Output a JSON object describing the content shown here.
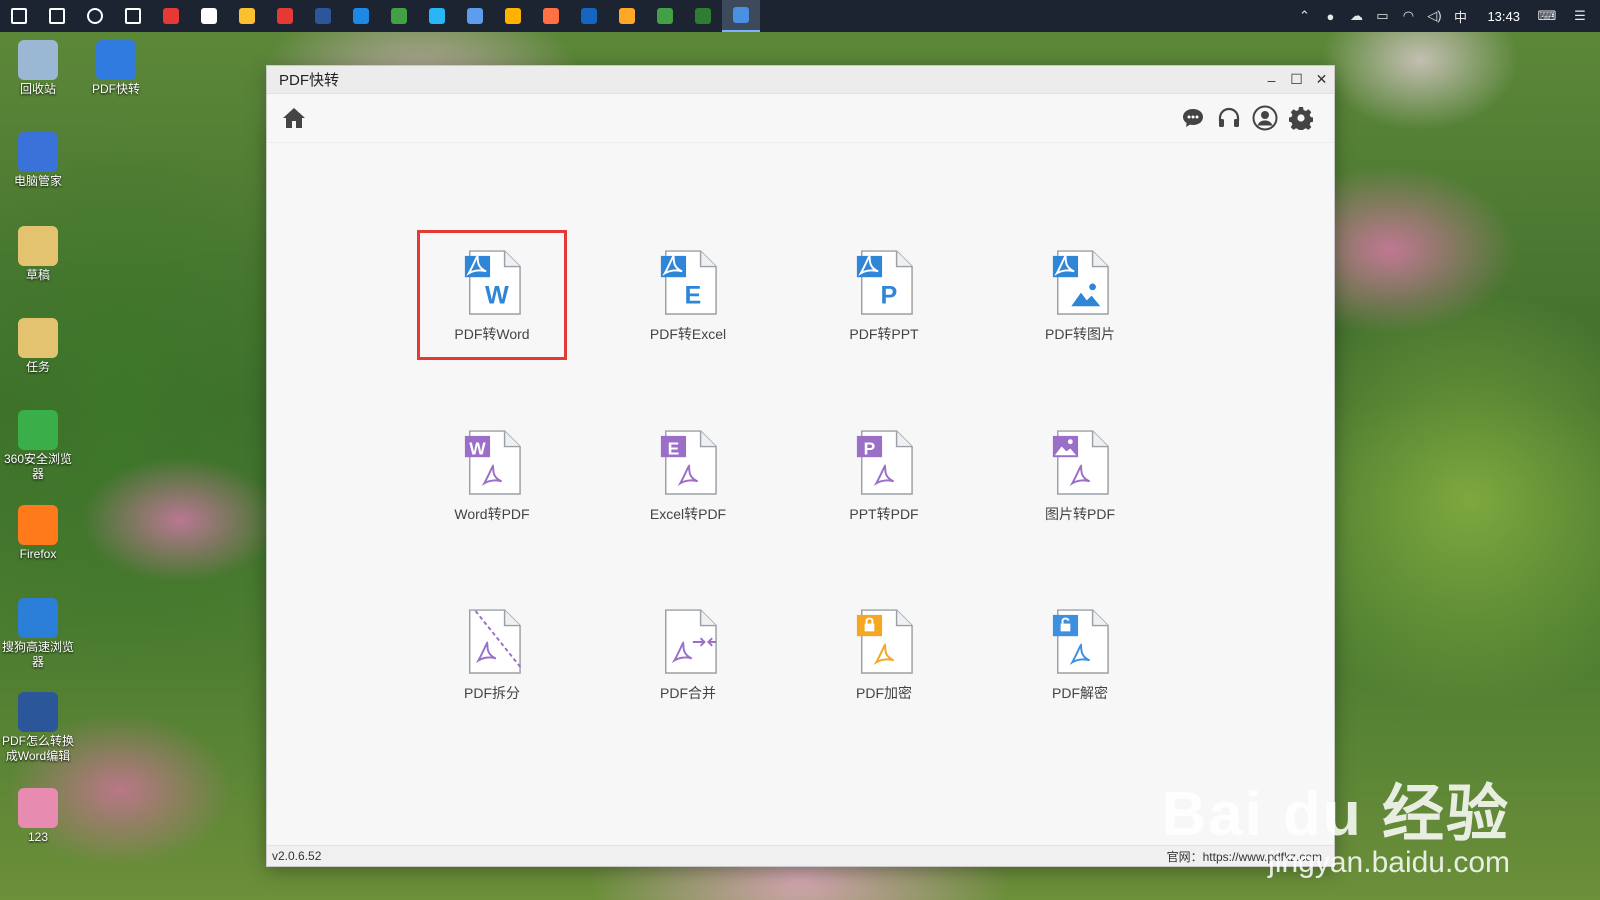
{
  "taskbar": {
    "icons": [
      {
        "name": "windows-start-icon",
        "color": "#ffffff"
      },
      {
        "name": "search-icon",
        "color": "#ffffff"
      },
      {
        "name": "cortana-icon",
        "color": "#ffffff"
      },
      {
        "name": "task-view-icon",
        "color": "#ffffff"
      },
      {
        "name": "app-red-icon",
        "color": "#e53935"
      },
      {
        "name": "file-white-icon",
        "color": "#ffffff"
      },
      {
        "name": "app-yellow-icon",
        "color": "#fbc02d"
      },
      {
        "name": "weibo-icon",
        "color": "#e53935"
      },
      {
        "name": "word-icon",
        "color": "#2b579a"
      },
      {
        "name": "edge-icon",
        "color": "#1e88e5"
      },
      {
        "name": "chrome-icon",
        "color": "#43a047"
      },
      {
        "name": "app-blue-icon",
        "color": "#29b6f6"
      },
      {
        "name": "app-pen-icon",
        "color": "#5c9ded"
      },
      {
        "name": "qq-icon",
        "color": "#ffb300"
      },
      {
        "name": "app-orange-icon",
        "color": "#ff7043"
      },
      {
        "name": "photoshop-icon",
        "color": "#1565c0"
      },
      {
        "name": "app-smile-icon",
        "color": "#ffa726"
      },
      {
        "name": "wechat-icon",
        "color": "#43a047"
      },
      {
        "name": "excel-icon",
        "color": "#2e7d32"
      },
      {
        "name": "pdf-kuaizhuan-taskbar-icon",
        "color": "#4a90e2",
        "active": true
      }
    ],
    "tray": {
      "ime": "中",
      "time": "13:43"
    }
  },
  "desktop": {
    "icons": [
      {
        "label": "回收站",
        "color": "#9ab7d3"
      },
      {
        "label": "PDF快转",
        "color": "#2f7be0"
      },
      {
        "label": "电脑管家",
        "color": "#3b72d9"
      },
      {
        "label": "草稿",
        "color": "#e3c370"
      },
      {
        "label": "任务",
        "color": "#e3c370"
      },
      {
        "label": "360安全浏览器",
        "color": "#3aae49"
      },
      {
        "label": "Firefox",
        "color": "#ff7a1a"
      },
      {
        "label": "搜狗高速浏览器",
        "color": "#2b7fd9"
      },
      {
        "label": "PDF怎么转换成Word编辑",
        "color": "#2b579a"
      },
      {
        "label": "123",
        "color": "#e88bb0"
      }
    ]
  },
  "window": {
    "title": "PDF快转",
    "controls": {
      "minimize": "–",
      "maximize": "☐",
      "close": "✕"
    },
    "version": "v2.0.6.52",
    "site": "官网：https://www.pdfkz.com"
  },
  "tools": [
    {
      "label": "PDF转Word",
      "letter": "W",
      "kind": "pdf-to",
      "accent": "#2f86d6",
      "selected": true
    },
    {
      "label": "PDF转Excel",
      "letter": "E",
      "kind": "pdf-to",
      "accent": "#2f86d6"
    },
    {
      "label": "PDF转PPT",
      "letter": "P",
      "kind": "pdf-to",
      "accent": "#2f86d6"
    },
    {
      "label": "PDF转图片",
      "letter": "",
      "kind": "pdf-to-image",
      "accent": "#2f86d6"
    },
    {
      "label": "Word转PDF",
      "letter": "W",
      "kind": "to-pdf",
      "accent": "#9b6fc7"
    },
    {
      "label": "Excel转PDF",
      "letter": "E",
      "kind": "to-pdf",
      "accent": "#9b6fc7"
    },
    {
      "label": "PPT转PDF",
      "letter": "P",
      "kind": "to-pdf",
      "accent": "#9b6fc7"
    },
    {
      "label": "图片转PDF",
      "letter": "",
      "kind": "image-to-pdf",
      "accent": "#9b6fc7"
    },
    {
      "label": "PDF拆分",
      "letter": "",
      "kind": "split",
      "accent": "#9b6fc7"
    },
    {
      "label": "PDF合并",
      "letter": "",
      "kind": "merge",
      "accent": "#9b6fc7"
    },
    {
      "label": "PDF加密",
      "letter": "",
      "kind": "encrypt",
      "accent": "#f5a623"
    },
    {
      "label": "PDF解密",
      "letter": "",
      "kind": "decrypt",
      "accent": "#3d8fe0"
    }
  ],
  "watermark": {
    "brand": "Bai du 经验",
    "url": "jingyan.baidu.com"
  }
}
